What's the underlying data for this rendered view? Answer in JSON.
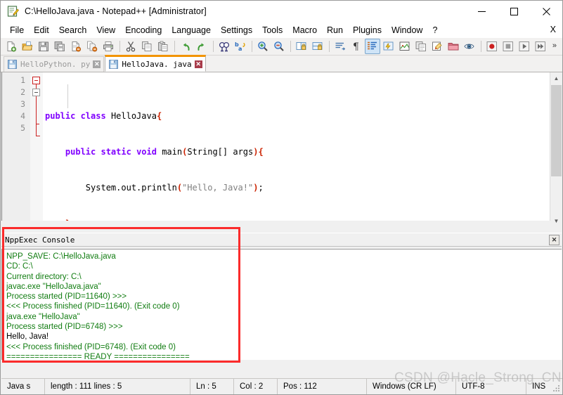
{
  "window": {
    "title": "C:\\HelloJava.java - Notepad++ [Administrator]",
    "icon": "notepad-plus-plus-icon",
    "minimize_label": "—",
    "maximize_label": "☐",
    "close_label": "✕"
  },
  "menubar": {
    "items": [
      {
        "label": "File"
      },
      {
        "label": "Edit"
      },
      {
        "label": "Search"
      },
      {
        "label": "View"
      },
      {
        "label": "Encoding"
      },
      {
        "label": "Language"
      },
      {
        "label": "Settings"
      },
      {
        "label": "Tools"
      },
      {
        "label": "Macro"
      },
      {
        "label": "Run"
      },
      {
        "label": "Plugins"
      },
      {
        "label": "Window"
      },
      {
        "label": "?"
      }
    ],
    "close_doc_label": "X"
  },
  "toolbar": {
    "overflow_label": "»",
    "buttons": [
      {
        "name": "new-file-icon",
        "title": "New"
      },
      {
        "name": "open-file-icon",
        "title": "Open"
      },
      {
        "name": "save-icon",
        "title": "Save"
      },
      {
        "name": "save-all-icon",
        "title": "Save All"
      },
      {
        "name": "close-file-icon",
        "title": "Close"
      },
      {
        "name": "close-all-icon",
        "title": "Close All"
      },
      {
        "name": "print-icon",
        "title": "Print"
      },
      {
        "name": "cut-icon",
        "title": "Cut"
      },
      {
        "name": "copy-icon",
        "title": "Copy"
      },
      {
        "name": "paste-icon",
        "title": "Paste"
      },
      {
        "name": "undo-icon",
        "title": "Undo"
      },
      {
        "name": "redo-icon",
        "title": "Redo"
      },
      {
        "name": "find-icon",
        "title": "Find"
      },
      {
        "name": "replace-icon",
        "title": "Replace"
      },
      {
        "name": "zoom-in-icon",
        "title": "Zoom In"
      },
      {
        "name": "zoom-out-icon",
        "title": "Zoom Out"
      },
      {
        "name": "sync-vertical-icon",
        "title": "Synchronize Vertical Scrolling"
      },
      {
        "name": "sync-horizontal-icon",
        "title": "Synchronize Horizontal Scrolling"
      },
      {
        "name": "word-wrap-icon",
        "title": "Word Wrap"
      },
      {
        "name": "show-all-chars-icon",
        "title": "Show All Characters"
      },
      {
        "name": "indent-guide-icon",
        "title": "Show Indent Guide"
      },
      {
        "name": "user-lang-icon",
        "title": "User Defined Dialogue"
      },
      {
        "name": "doc-map-icon",
        "title": "Document Map"
      },
      {
        "name": "function-list-icon",
        "title": "Function List"
      },
      {
        "name": "doc-switcher-icon",
        "title": "Document List"
      },
      {
        "name": "folder-workspace-icon",
        "title": "Folder as Workspace"
      },
      {
        "name": "monitor-icon",
        "title": "Monitoring"
      },
      {
        "name": "macro-record-icon",
        "title": "Start Recording"
      },
      {
        "name": "macro-stop-icon",
        "title": "Stop Recording"
      },
      {
        "name": "macro-play-icon",
        "title": "Playback"
      },
      {
        "name": "macro-runmulti-icon",
        "title": "Run a Macro Multiple Times"
      }
    ]
  },
  "tabs": [
    {
      "label": "HelloPython. py",
      "active": false,
      "close_label": "✕"
    },
    {
      "label": "HelloJava. java",
      "active": true,
      "close_label": "✕"
    }
  ],
  "editor": {
    "line_numbers": [
      "1",
      "2",
      "3",
      "4",
      "5"
    ],
    "current_line": 5,
    "lines": [
      {
        "n": 1,
        "tokens": [
          {
            "t": "public ",
            "c": "kw"
          },
          {
            "t": "class ",
            "c": "kw"
          },
          {
            "t": "HelloJava",
            "c": "id"
          },
          {
            "t": "{",
            "c": "br"
          }
        ]
      },
      {
        "n": 2,
        "tokens": [
          {
            "t": "    ",
            "c": "id"
          },
          {
            "t": "public ",
            "c": "kw"
          },
          {
            "t": "static ",
            "c": "kw"
          },
          {
            "t": "void ",
            "c": "kw"
          },
          {
            "t": "main",
            "c": "id"
          },
          {
            "t": "(",
            "c": "br"
          },
          {
            "t": "String[] args",
            "c": "id"
          },
          {
            "t": ")",
            "c": "br"
          },
          {
            "t": "{",
            "c": "br"
          }
        ]
      },
      {
        "n": 3,
        "tokens": [
          {
            "t": "        ",
            "c": "id"
          },
          {
            "t": "System.out.println",
            "c": "id"
          },
          {
            "t": "(",
            "c": "br"
          },
          {
            "t": "\"Hello, Java!\"",
            "c": "str"
          },
          {
            "t": ")",
            "c": "br"
          },
          {
            "t": ";",
            "c": "id"
          }
        ]
      },
      {
        "n": 4,
        "tokens": [
          {
            "t": "    ",
            "c": "id"
          },
          {
            "t": "}",
            "c": "br"
          }
        ]
      },
      {
        "n": 5,
        "tokens": [
          {
            "t": "}",
            "c": "br"
          }
        ]
      }
    ]
  },
  "console": {
    "title": "NppExec Console",
    "close_label": "✕",
    "lines": [
      {
        "text": "NPP_SAVE: C:\\HelloJava.java",
        "color": "green"
      },
      {
        "text": "CD: C:\\",
        "color": "green"
      },
      {
        "text": "Current directory: C:\\",
        "color": "green"
      },
      {
        "text": "javac.exe \"HelloJava.java\"",
        "color": "green"
      },
      {
        "text": "Process started (PID=11640) >>>",
        "color": "green"
      },
      {
        "text": "<<< Process finished (PID=11640). (Exit code 0)",
        "color": "green"
      },
      {
        "text": "java.exe \"HelloJava\"",
        "color": "green"
      },
      {
        "text": "Process started (PID=6748) >>>",
        "color": "green"
      },
      {
        "text": "Hello, Java!",
        "color": "black"
      },
      {
        "text": "<<< Process finished (PID=6748). (Exit code 0)",
        "color": "green"
      },
      {
        "text": "================ READY ================",
        "color": "green"
      }
    ]
  },
  "statusbar": {
    "language": "Java s",
    "length_lines": "length : 111     lines : 5",
    "ln": "Ln : 5",
    "col": "Col : 2",
    "pos": "Pos : 112",
    "eol": "Windows (CR LF)",
    "encoding": "UTF-8",
    "insert_mode": "INS"
  },
  "watermark": {
    "text": "CSDN @Hacle_Strong_CN"
  },
  "annotation": {
    "name": "red-highlight-box",
    "color": "#fb2b2b"
  },
  "colors": {
    "accent_tab": "#f29400",
    "console_green": "#107c10",
    "keyword_purple": "#8000ff",
    "bracket_red": "#cc2200",
    "string_grey": "#808080",
    "annotation_red": "#fb2b2b"
  }
}
